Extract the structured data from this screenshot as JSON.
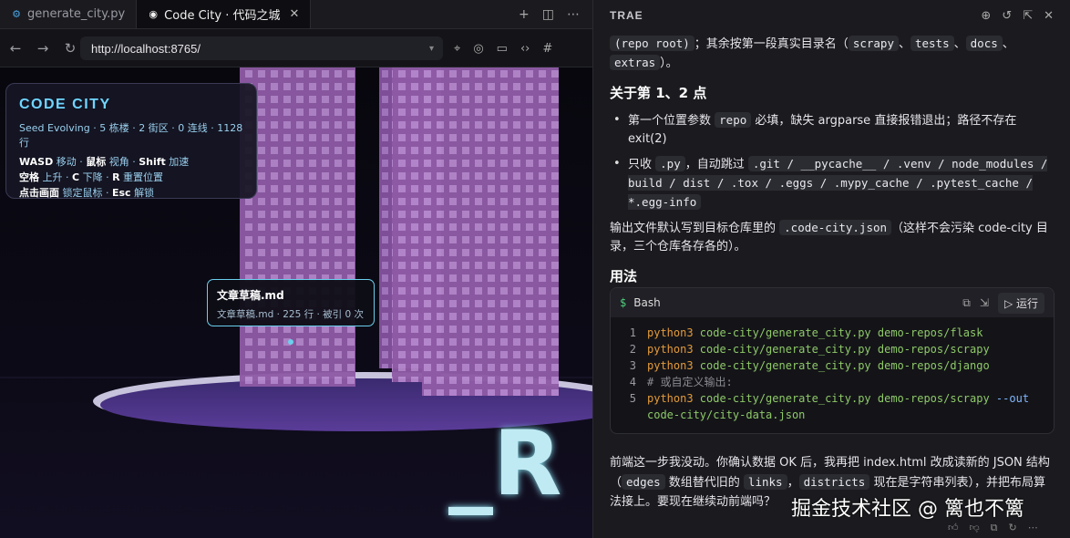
{
  "tabs": [
    {
      "label": "generate_city.py",
      "icon": "python-file-icon",
      "active": false
    },
    {
      "label": "Code City · 代码之城",
      "icon": "eye-icon",
      "active": true,
      "close": "✕"
    }
  ],
  "tabbar_actions": [
    "plus-icon",
    "split-icon",
    "more-icon"
  ],
  "nav": {
    "url": "http://localhost:8765/"
  },
  "hud": {
    "title": "CODE CITY",
    "stats": "Seed Evolving · 5 栋楼 · 2 街区 · 0 连线 · 1128 行",
    "controls": [
      [
        {
          "k": "WASD",
          "v": " 移动 · "
        },
        {
          "k": "鼠标",
          "v": " 视角 · "
        },
        {
          "k": "Shift",
          "v": " 加速"
        }
      ],
      [
        {
          "k": "空格",
          "v": " 上升 · "
        },
        {
          "k": "C",
          "v": " 下降 · "
        },
        {
          "k": "R",
          "v": " 重置位置"
        }
      ],
      [
        {
          "k": "点击画面",
          "v": " 锁定鼠标 · "
        },
        {
          "k": "Esc",
          "v": " 解锁"
        }
      ]
    ]
  },
  "tooltip": {
    "title": "文章草稿.md",
    "detail": "文章草稿.md · 225 行 · 被引 0 次"
  },
  "scene": {
    "big_text": "_R",
    "colors": {
      "building": "#8e5aa5",
      "window": "#b888cc",
      "plaza": "#3e2d78",
      "rim": "#c4c0dc",
      "neon": "#bff6ff"
    }
  },
  "right": {
    "brand": "TRAE",
    "header_icons": [
      "add-chat-icon",
      "history-icon",
      "open-external-icon",
      "close-icon"
    ],
    "p1": [
      {
        "t": "code",
        "v": "(repo root)"
      },
      {
        "t": "text",
        "v": "；其余按第一段真实目录名（"
      },
      {
        "t": "code",
        "v": "scrapy"
      },
      {
        "t": "text",
        "v": "、"
      },
      {
        "t": "code",
        "v": "tests"
      },
      {
        "t": "text",
        "v": "、"
      },
      {
        "t": "code",
        "v": "docs"
      },
      {
        "t": "text",
        "v": "、"
      },
      {
        "t": "code",
        "v": "extras"
      },
      {
        "t": "text",
        "v": "）。"
      }
    ],
    "h_points": "关于第 1、2 点",
    "bullet1": [
      {
        "t": "text",
        "v": "第一个位置参数 "
      },
      {
        "t": "code",
        "v": "repo"
      },
      {
        "t": "text",
        "v": " 必填，缺失 argparse 直接报错退出；路径不存在 exit(2)"
      }
    ],
    "bullet2": [
      {
        "t": "text",
        "v": "只收 "
      },
      {
        "t": "code",
        "v": ".py"
      },
      {
        "t": "text",
        "v": "，自动跳过 "
      },
      {
        "t": "code",
        "v": ".git / __pycache__ / .venv / node_modules / build / dist / .tox / .eggs / .mypy_cache / .pytest_cache / *.egg-info"
      }
    ],
    "p2": [
      {
        "t": "text",
        "v": "输出文件默认写到目标仓库里的 "
      },
      {
        "t": "code",
        "v": ".code-city.json"
      },
      {
        "t": "text",
        "v": "（这样不会污染 code-city 目录，三个仓库各存各的）。"
      }
    ],
    "h_usage": "用法",
    "codeblock": {
      "lang": "Bash",
      "run_label": "运行",
      "lines": [
        {
          "n": "1",
          "parts": [
            {
              "c": "kw",
              "v": "python3"
            },
            {
              "c": "str",
              "v": " code-city/generate_city.py demo-repos/flask"
            }
          ]
        },
        {
          "n": "2",
          "parts": [
            {
              "c": "kw",
              "v": "python3"
            },
            {
              "c": "str",
              "v": " code-city/generate_city.py demo-repos/scrapy"
            }
          ]
        },
        {
          "n": "3",
          "parts": [
            {
              "c": "kw",
              "v": "python3"
            },
            {
              "c": "str",
              "v": " code-city/generate_city.py demo-repos/django"
            }
          ]
        },
        {
          "n": "4",
          "parts": [
            {
              "c": "cm",
              "v": "# 或自定义输出:"
            }
          ]
        },
        {
          "n": "5",
          "parts": [
            {
              "c": "kw",
              "v": "python3"
            },
            {
              "c": "str",
              "v": " code-city/generate_city.py demo-repos/scrapy "
            },
            {
              "c": "flag",
              "v": "--out"
            }
          ]
        },
        {
          "n": "",
          "parts": [
            {
              "c": "str",
              "v": "code-city/city-data.json"
            }
          ]
        }
      ]
    },
    "p3": [
      {
        "t": "text",
        "v": "前端这一步我没动。你确认数据 OK 后，我再把 index.html 改成读新的 JSON 结构（"
      },
      {
        "t": "code",
        "v": "edges"
      },
      {
        "t": "text",
        "v": " 数组替代旧的 "
      },
      {
        "t": "code",
        "v": "links"
      },
      {
        "t": "text",
        "v": "，"
      },
      {
        "t": "code",
        "v": "districts"
      },
      {
        "t": "text",
        "v": " 现在是字符串列表），并把布局算法接上。要现在继续动前端吗？"
      }
    ],
    "watermark": "掘金技术社区 @ 篱也不篱",
    "feedback_icons": [
      "thumb-up-icon",
      "thumb-down-icon",
      "copy-icon",
      "regenerate-icon",
      "more-icon"
    ]
  }
}
